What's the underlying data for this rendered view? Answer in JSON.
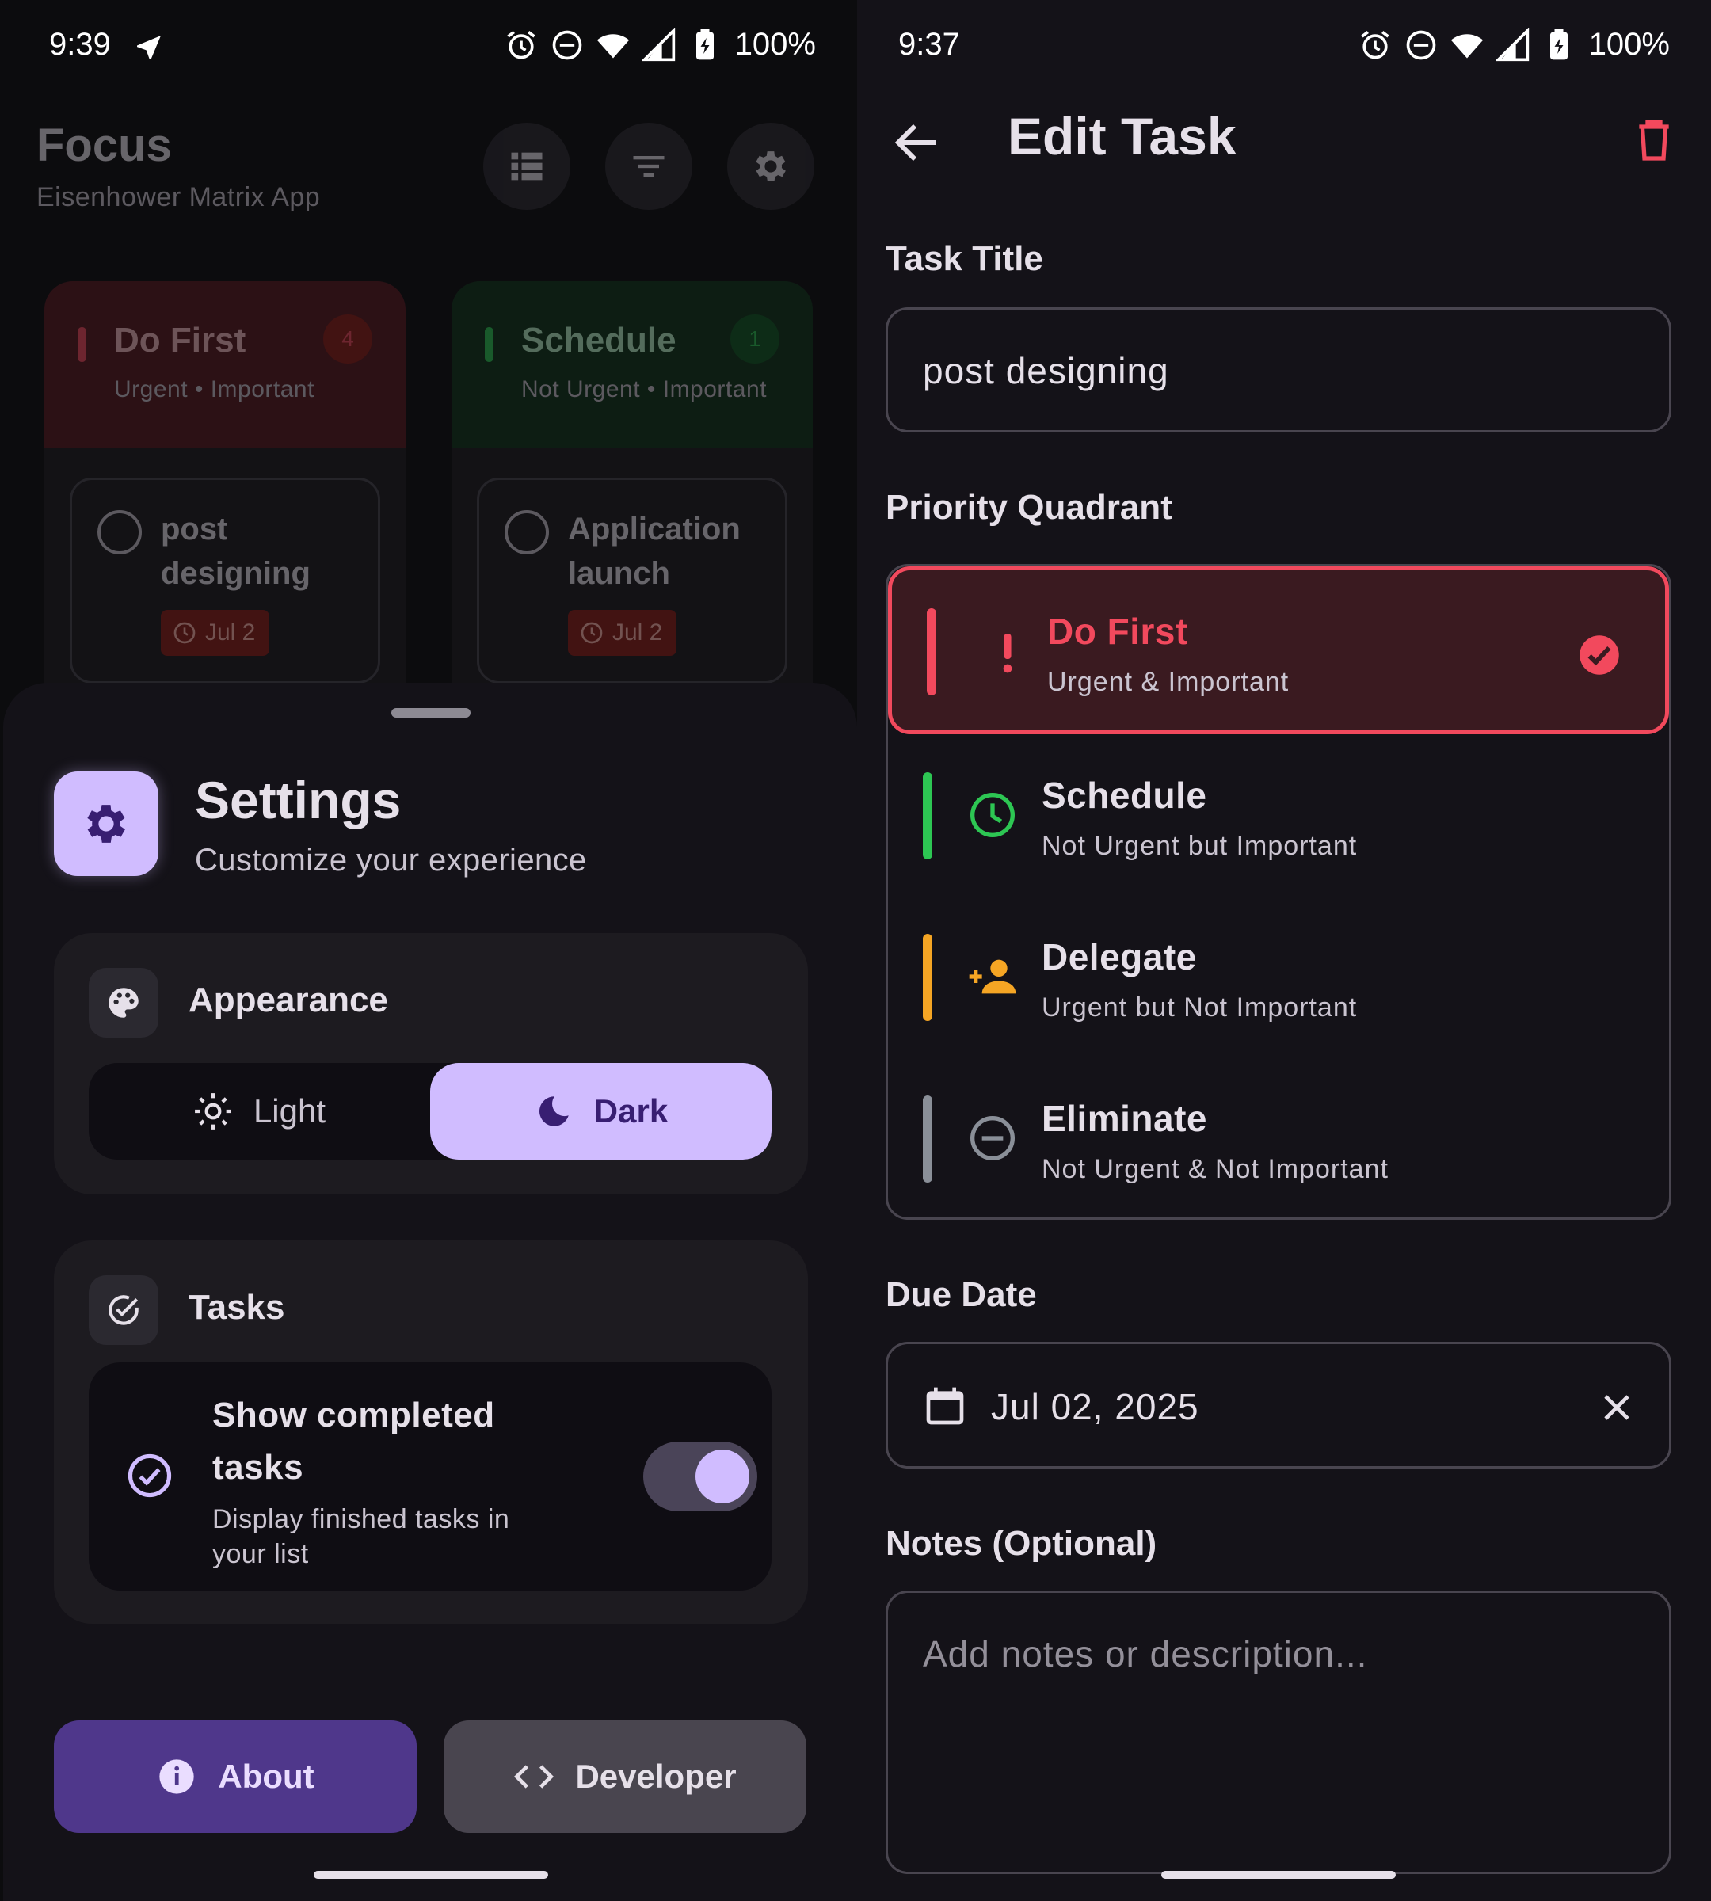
{
  "left": {
    "status": {
      "time": "9:39",
      "battery": "100%"
    },
    "app": {
      "title": "Focus",
      "subtitle": "Eisenhower Matrix App",
      "quadrants": [
        {
          "name": "Do First",
          "desc": "Urgent • Important",
          "count": "4",
          "color": "#F2495D",
          "task": {
            "title": "post designing",
            "date": "Jul 2"
          }
        },
        {
          "name": "Schedule",
          "desc": "Not Urgent • Important",
          "count": "1",
          "color": "#2DC653",
          "task": {
            "title": "Application launch",
            "date": "Jul 2"
          }
        }
      ]
    },
    "settings": {
      "title": "Settings",
      "subtitle": "Customize your experience",
      "appearance": {
        "title": "Appearance",
        "light": "Light",
        "dark": "Dark",
        "selected": "Dark"
      },
      "tasks": {
        "title": "Tasks",
        "toggle_title": "Show completed tasks",
        "toggle_desc": "Display finished tasks in your list",
        "toggle_on": true
      },
      "about_label": "About",
      "developer_label": "Developer"
    }
  },
  "right": {
    "status": {
      "time": "9:37",
      "battery": "100%"
    },
    "title": "Edit Task",
    "task_title_label": "Task Title",
    "task_title_value": "post designing",
    "priority_label": "Priority Quadrant",
    "quadrants": [
      {
        "name": "Do First",
        "desc": "Urgent & Important",
        "color": "#F2495D",
        "icon": "exclamation-icon",
        "selected": true
      },
      {
        "name": "Schedule",
        "desc": "Not Urgent but Important",
        "color": "#2DC653",
        "icon": "clock-icon",
        "selected": false
      },
      {
        "name": "Delegate",
        "desc": "Urgent but Not Important",
        "color": "#F5A524",
        "icon": "person-add-icon",
        "selected": false
      },
      {
        "name": "Eliminate",
        "desc": "Not Urgent & Not Important",
        "color": "#8A8F98",
        "icon": "minus-circle-icon",
        "selected": false
      }
    ],
    "due_label": "Due Date",
    "due_value": "Jul 02, 2025",
    "notes_label": "Notes (Optional)",
    "notes_placeholder": "Add notes or description..."
  }
}
